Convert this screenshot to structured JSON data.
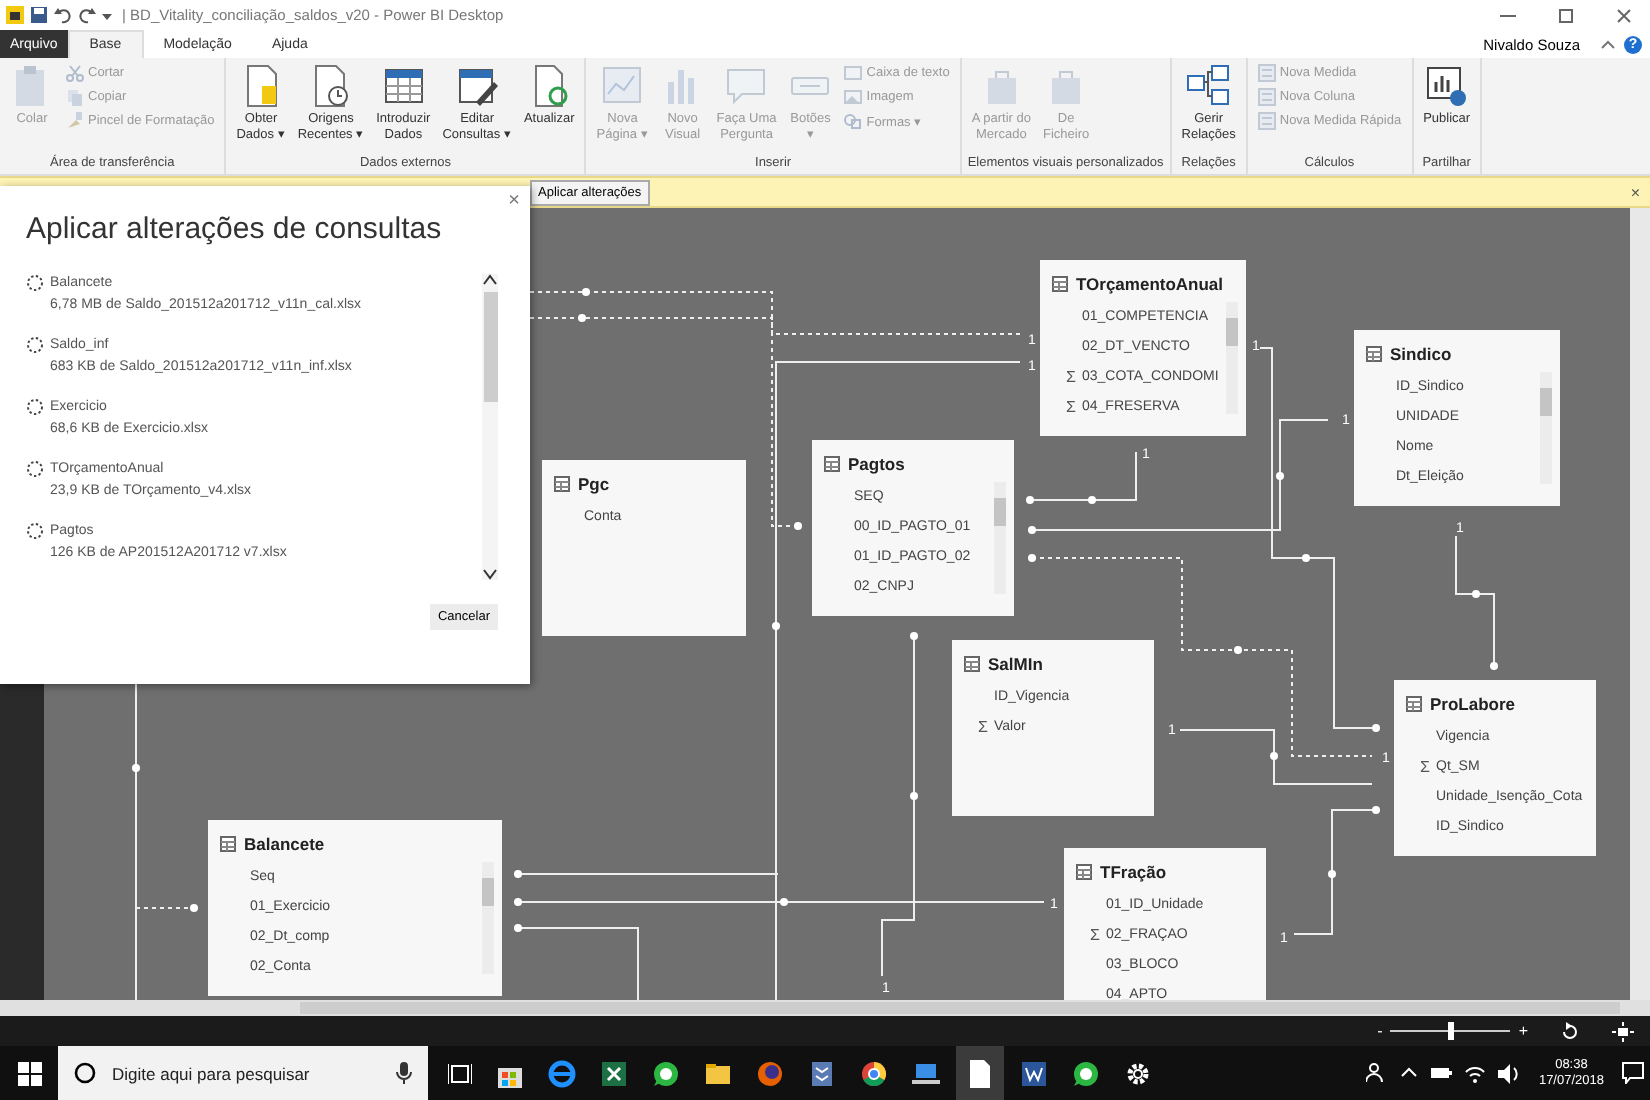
{
  "window": {
    "title": "| BD_Vitality_conciliação_saldos_v20 - Power BI Desktop",
    "user": "Nivaldo Souza",
    "help": "?"
  },
  "tabs": [
    {
      "label": "Arquivo",
      "kind": "file",
      "selected": false
    },
    {
      "label": "Base",
      "kind": "tab",
      "selected": true
    },
    {
      "label": "Modelação",
      "kind": "tab",
      "selected": false
    },
    {
      "label": "Ajuda",
      "kind": "tab",
      "selected": false
    }
  ],
  "ribbon": [
    {
      "label": "Área de transferência",
      "items": [
        {
          "kind": "large",
          "lines": [
            "Colar"
          ],
          "disabled": true
        },
        {
          "kind": "small",
          "lines": [
            "Cortar"
          ],
          "disabled": true
        },
        {
          "kind": "small",
          "lines": [
            "Copiar"
          ],
          "disabled": true
        },
        {
          "kind": "small",
          "lines": [
            "Pincel de Formatação"
          ],
          "disabled": true
        }
      ]
    },
    {
      "label": "Dados externos",
      "items": [
        {
          "kind": "large",
          "lines": [
            "Obter",
            "Dados ▾"
          ],
          "disabled": false
        },
        {
          "kind": "large",
          "lines": [
            "Origens",
            "Recentes ▾"
          ],
          "disabled": false
        },
        {
          "kind": "large",
          "lines": [
            "Introduzir",
            "Dados"
          ],
          "disabled": false
        },
        {
          "kind": "large",
          "lines": [
            "Editar",
            "Consultas ▾"
          ],
          "disabled": false
        },
        {
          "kind": "large",
          "lines": [
            "Atualizar"
          ],
          "disabled": false
        }
      ]
    },
    {
      "label": "Inserir",
      "items": [
        {
          "kind": "large",
          "lines": [
            "Nova",
            "Página ▾"
          ],
          "disabled": true
        },
        {
          "kind": "large",
          "lines": [
            "Novo",
            "Visual"
          ],
          "disabled": true
        },
        {
          "kind": "large",
          "lines": [
            "Faça Uma",
            "Pergunta"
          ],
          "disabled": true
        },
        {
          "kind": "large",
          "lines": [
            "Botões",
            "▾"
          ],
          "disabled": true
        },
        {
          "kind": "small",
          "lines": [
            "Caixa de texto"
          ],
          "disabled": true
        },
        {
          "kind": "small",
          "lines": [
            "Imagem"
          ],
          "disabled": true
        },
        {
          "kind": "small",
          "lines": [
            "Formas ▾"
          ],
          "disabled": true
        }
      ]
    },
    {
      "label": "Elementos visuais personalizados",
      "items": [
        {
          "kind": "large",
          "lines": [
            "A partir do",
            "Mercado"
          ],
          "disabled": true
        },
        {
          "kind": "large",
          "lines": [
            "De",
            "Ficheiro"
          ],
          "disabled": true
        }
      ]
    },
    {
      "label": "Relações",
      "items": [
        {
          "kind": "large",
          "lines": [
            "Gerir",
            "Relações"
          ],
          "disabled": false
        }
      ]
    },
    {
      "label": "Cálculos",
      "items": [
        {
          "kind": "small",
          "lines": [
            "Nova Medida"
          ],
          "disabled": true
        },
        {
          "kind": "small",
          "lines": [
            "Nova Coluna"
          ],
          "disabled": true
        },
        {
          "kind": "small",
          "lines": [
            "Nova Medida Rápida"
          ],
          "disabled": true
        }
      ]
    },
    {
      "label": "Partilhar",
      "items": [
        {
          "kind": "large",
          "lines": [
            "Publicar"
          ],
          "disabled": false
        }
      ]
    }
  ],
  "notification": {
    "button": "Aplicar alterações",
    "close": "×"
  },
  "dialog": {
    "title": "Aplicar alterações de consultas",
    "close": "×",
    "items": [
      {
        "name": "Balancete",
        "detail": "6,78 MB de Saldo_201512a201712_v11n_cal.xlsx"
      },
      {
        "name": "Saldo_inf",
        "detail": "683 KB de Saldo_201512a201712_v11n_inf.xlsx"
      },
      {
        "name": "Exercicio",
        "detail": "68,6 KB de Exercicio.xlsx"
      },
      {
        "name": "TOrçamentoAnual",
        "detail": "23,9 KB de TOrçamento_v4.xlsx"
      },
      {
        "name": "Pagtos",
        "detail": "126 KB de AP201512A201712 v7.xlsx"
      }
    ],
    "button": "Cancelar"
  },
  "tables": [
    {
      "name": "TOrçamentoAnual",
      "scrollbar": true,
      "fields": [
        {
          "name": "01_COMPETENCIA"
        },
        {
          "name": "02_DT_VENCTO"
        },
        {
          "name": "03_COTA_CONDOMI",
          "icon": "Σ"
        },
        {
          "name": "04_FRESERVA",
          "icon": "Σ"
        }
      ]
    },
    {
      "name": "Sindico",
      "scrollbar": true,
      "fields": [
        {
          "name": "ID_Sindico"
        },
        {
          "name": "UNIDADE"
        },
        {
          "name": "Nome"
        },
        {
          "name": "Dt_Eleição"
        }
      ]
    },
    {
      "name": "Pgc",
      "scrollbar": false,
      "fields": [
        {
          "name": "Conta"
        }
      ]
    },
    {
      "name": "Pagtos",
      "scrollbar": true,
      "fields": [
        {
          "name": "SEQ"
        },
        {
          "name": "00_ID_PAGTO_01"
        },
        {
          "name": "01_ID_PAGTO_02"
        },
        {
          "name": "02_CNPJ"
        }
      ]
    },
    {
      "name": "SalMIn",
      "scrollbar": false,
      "fields": [
        {
          "name": "ID_Vigencia"
        },
        {
          "name": "Valor",
          "icon": "Σ"
        }
      ]
    },
    {
      "name": "ProLabore",
      "scrollbar": false,
      "fields": [
        {
          "name": "Vigencia"
        },
        {
          "name": "Qt_SM",
          "icon": "Σ"
        },
        {
          "name": "Unidade_Isenção_Cota"
        },
        {
          "name": "ID_Sindico"
        }
      ]
    },
    {
      "name": "Balancete",
      "scrollbar": true,
      "fields": [
        {
          "name": "Seq"
        },
        {
          "name": "01_Exercicio"
        },
        {
          "name": "02_Dt_comp"
        },
        {
          "name": "02_Conta"
        }
      ]
    },
    {
      "name": "TFração",
      "scrollbar": false,
      "fields": [
        {
          "name": "01_ID_Unidade"
        },
        {
          "name": "02_FRAÇAO",
          "icon": "Σ"
        },
        {
          "name": "03_BLOCO"
        },
        {
          "name": "04_APTO"
        }
      ]
    }
  ],
  "relationships": [
    {
      "cardinality": "1",
      "dashed": true
    },
    {
      "dashed": true
    },
    {
      "cardinality": "1",
      "dashed": false
    },
    {
      "cardinality": "1",
      "dashed": false
    },
    {
      "cardinality": "1",
      "dashed": false
    },
    {
      "cardinality": "1",
      "dashed": false
    },
    {
      "cardinality": "1",
      "dashed": true
    },
    {
      "cardinality": "1",
      "dashed": false
    },
    {
      "cardinality": "1",
      "dashed": false
    },
    {
      "cardinality": "1",
      "dashed": false
    },
    {
      "dashed": false
    },
    {
      "cardinality": "1",
      "dashed": false
    },
    {
      "dashed": false
    },
    {
      "cardinality": "1",
      "dashed": false
    },
    {
      "dashed": false
    },
    {
      "dashed": true
    }
  ],
  "taskbar": {
    "search": {
      "placeholder": "Digite aqui para pesquisar"
    },
    "time": "08:38",
    "date": "17/07/2018"
  },
  "zoom": {
    "minus": "-",
    "plus": "+",
    "level": 0.5
  }
}
